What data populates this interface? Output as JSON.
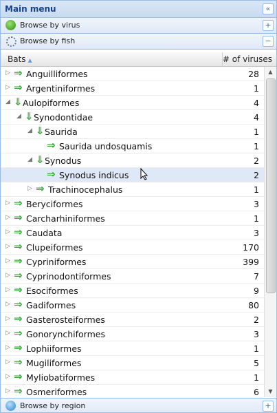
{
  "panel": {
    "title": "Main menu",
    "collapse_glyph": "«"
  },
  "sections": [
    {
      "label": "Browse by virus",
      "glyph": "+",
      "icon": "virus-globe-icon"
    },
    {
      "label": "Browse by fish",
      "glyph": "−",
      "icon": "fish-icon"
    },
    {
      "label": "Browse by region",
      "glyph": "+",
      "icon": "region-globe-icon"
    }
  ],
  "table": {
    "col_name": "Bats",
    "sort_glyph": "▲",
    "col_count": "# of viruses",
    "rows": [
      {
        "name": "Anguilliformes",
        "count": "28",
        "level": 0,
        "state": "collapsed",
        "arrow": "right"
      },
      {
        "name": "Argentiniformes",
        "count": "1",
        "level": 0,
        "state": "collapsed",
        "arrow": "right"
      },
      {
        "name": "Aulopiformes",
        "count": "4",
        "level": 0,
        "state": "expanded",
        "arrow": "down"
      },
      {
        "name": "Synodontidae",
        "count": "4",
        "level": 1,
        "state": "expanded",
        "arrow": "down"
      },
      {
        "name": "Saurida",
        "count": "1",
        "level": 2,
        "state": "expanded",
        "arrow": "down"
      },
      {
        "name": "Saurida undosquamis",
        "count": "1",
        "level": 3,
        "state": "leaf",
        "arrow": "right"
      },
      {
        "name": "Synodus",
        "count": "2",
        "level": 2,
        "state": "expanded",
        "arrow": "down"
      },
      {
        "name": "Synodus indicus",
        "count": "2",
        "level": 3,
        "state": "leaf",
        "arrow": "right",
        "selected": true
      },
      {
        "name": "Trachinocephalus",
        "count": "1",
        "level": 2,
        "state": "collapsed",
        "arrow": "right"
      },
      {
        "name": "Beryciformes",
        "count": "3",
        "level": 0,
        "state": "collapsed",
        "arrow": "right"
      },
      {
        "name": "Carcharhiniformes",
        "count": "1",
        "level": 0,
        "state": "collapsed",
        "arrow": "right"
      },
      {
        "name": "Caudata",
        "count": "3",
        "level": 0,
        "state": "collapsed",
        "arrow": "right"
      },
      {
        "name": "Clupeiformes",
        "count": "170",
        "level": 0,
        "state": "collapsed",
        "arrow": "right"
      },
      {
        "name": "Cypriniformes",
        "count": "399",
        "level": 0,
        "state": "collapsed",
        "arrow": "right"
      },
      {
        "name": "Cyprinodontiformes",
        "count": "7",
        "level": 0,
        "state": "collapsed",
        "arrow": "right"
      },
      {
        "name": "Esociformes",
        "count": "9",
        "level": 0,
        "state": "collapsed",
        "arrow": "right"
      },
      {
        "name": "Gadiformes",
        "count": "80",
        "level": 0,
        "state": "collapsed",
        "arrow": "right"
      },
      {
        "name": "Gasterosteiformes",
        "count": "2",
        "level": 0,
        "state": "collapsed",
        "arrow": "right"
      },
      {
        "name": "Gonorynchiformes",
        "count": "3",
        "level": 0,
        "state": "collapsed",
        "arrow": "right"
      },
      {
        "name": "Lophiiformes",
        "count": "1",
        "level": 0,
        "state": "collapsed",
        "arrow": "right"
      },
      {
        "name": "Mugiliformes",
        "count": "5",
        "level": 0,
        "state": "collapsed",
        "arrow": "right"
      },
      {
        "name": "Myliobatiformes",
        "count": "1",
        "level": 0,
        "state": "collapsed",
        "arrow": "right"
      },
      {
        "name": "Osmeriformes",
        "count": "6",
        "level": 0,
        "state": "collapsed",
        "arrow": "right"
      }
    ]
  },
  "colors": {
    "header_text": "#15428b",
    "border": "#99bbe8",
    "arrow_green": "#3aa83a",
    "selected_row": "#dfe8f6"
  }
}
